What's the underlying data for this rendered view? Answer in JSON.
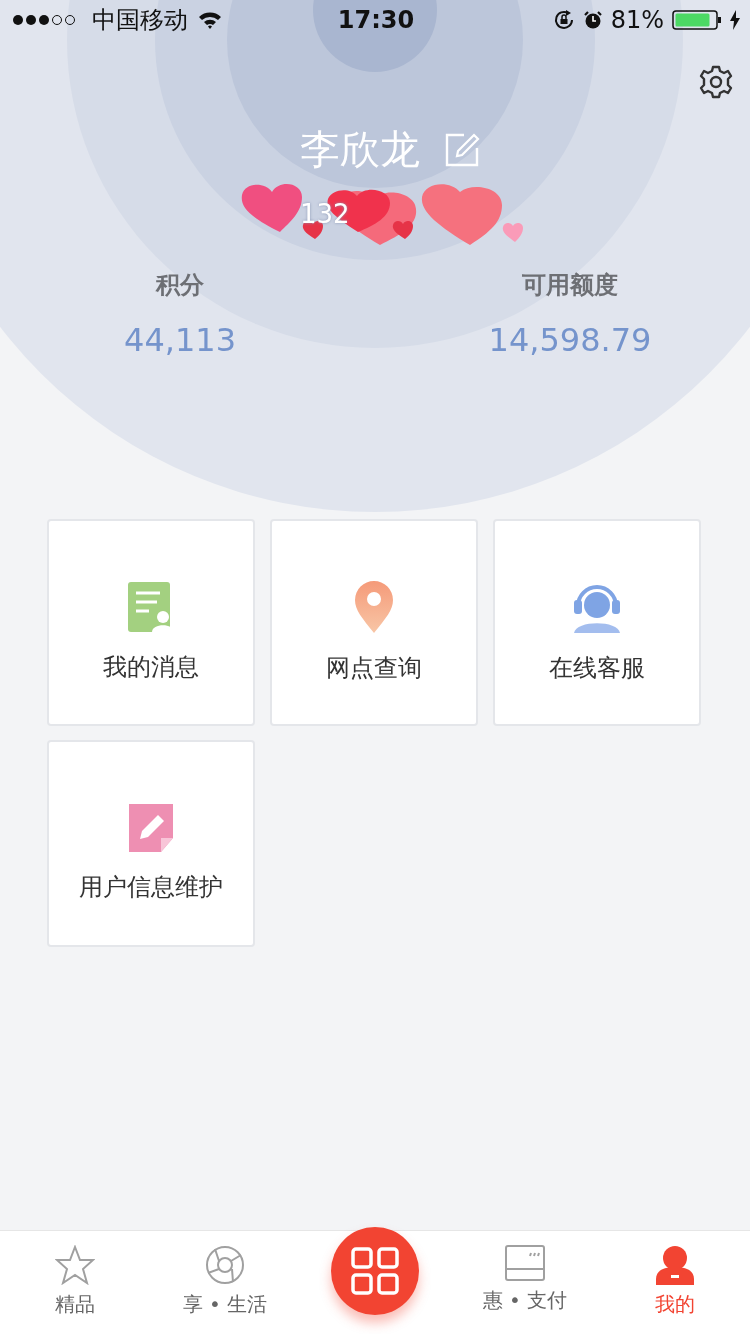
{
  "status_bar": {
    "carrier": "中国移动",
    "time": "17:30",
    "battery": "81%"
  },
  "profile": {
    "name": "李欣龙",
    "phone": "132"
  },
  "stats": [
    {
      "label": "积分",
      "value": "44,113"
    },
    {
      "label": "可用额度",
      "value": "14,598.79"
    }
  ],
  "tiles": [
    {
      "kind": "message",
      "label": "我的消息"
    },
    {
      "kind": "location",
      "label": "网点查询"
    },
    {
      "kind": "service",
      "label": "在线客服"
    },
    {
      "kind": "edit",
      "label": "用户信息维护"
    }
  ],
  "tab_bar": [
    {
      "kind": "star",
      "label": "精品",
      "selected": false
    },
    {
      "kind": "aperture",
      "label": "享 • 生活",
      "selected": false
    },
    {
      "kind": "center",
      "selected": false
    },
    {
      "kind": "card",
      "label": "惠 • 支付",
      "selected": false
    },
    {
      "kind": "person",
      "label": "我的",
      "selected": true
    }
  ]
}
